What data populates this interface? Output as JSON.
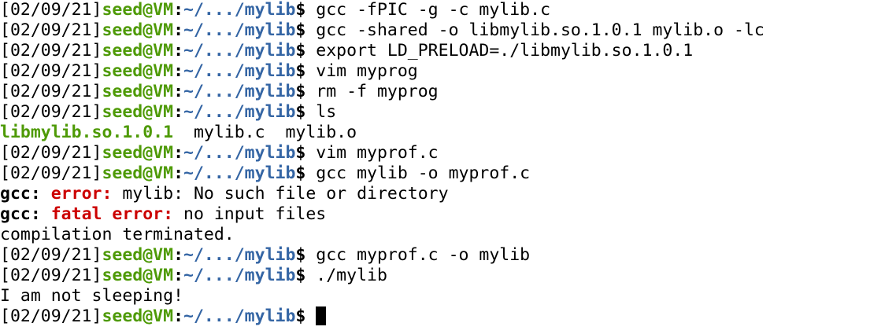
{
  "terminal": {
    "prompt": {
      "timestamp": "[02/09/21]",
      "user_host": "seed@VM",
      "colon": ":",
      "path": "~/.../mylib",
      "dollar": "$ "
    },
    "lines": [
      {
        "type": "prompt",
        "command": "gcc -fPIC -g -c mylib.c"
      },
      {
        "type": "prompt",
        "command": "gcc -shared -o libmylib.so.1.0.1 mylib.o -lc"
      },
      {
        "type": "prompt",
        "command": "export LD_PRELOAD=./libmylib.so.1.0.1"
      },
      {
        "type": "prompt",
        "command": "vim myprog"
      },
      {
        "type": "prompt",
        "command": "rm -f myprog"
      },
      {
        "type": "prompt",
        "command": "ls"
      },
      {
        "type": "ls",
        "exec_file": "libmylib.so.1.0.1",
        "rest": "  mylib.c  mylib.o"
      },
      {
        "type": "prompt",
        "command": "vim myprof.c"
      },
      {
        "type": "prompt",
        "command": "gcc mylib -o myprof.c"
      },
      {
        "type": "error",
        "prefix": "gcc:",
        "label": "error:",
        "message": "mylib: No such file or directory"
      },
      {
        "type": "error",
        "prefix": "gcc:",
        "label": "fatal error:",
        "message": "no input files"
      },
      {
        "type": "output",
        "text": "compilation terminated."
      },
      {
        "type": "prompt",
        "command": "gcc myprof.c -o mylib"
      },
      {
        "type": "prompt",
        "command": "./mylib"
      },
      {
        "type": "output",
        "text": "I am not sleeping!"
      },
      {
        "type": "prompt",
        "command": "",
        "cursor": true
      }
    ],
    "colors": {
      "background": "#ffffff",
      "text": "#000000",
      "user_host": "#4e9a06",
      "path": "#3465a4",
      "error": "#cc0000",
      "executable": "#4e9a06"
    }
  }
}
